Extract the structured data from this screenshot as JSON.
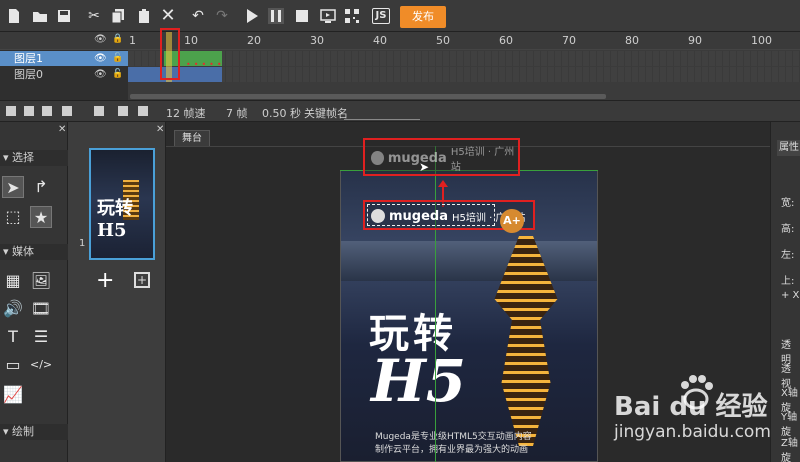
{
  "toolbar": {
    "publish_label": "发布",
    "icons": [
      "new-file-icon",
      "open-folder-icon",
      "save-icon",
      "cut-icon",
      "copy-icon",
      "paste-icon",
      "delete-icon",
      "undo-icon",
      "redo-icon",
      "play-icon",
      "pause-icon",
      "stop-icon",
      "preview-icon",
      "qrcode-icon",
      "js-icon"
    ],
    "accent_color": "#f08c28"
  },
  "timeline": {
    "ruler": [
      "1",
      "10",
      "20",
      "30",
      "40",
      "50",
      "60",
      "70",
      "80",
      "90",
      "100"
    ],
    "layers": [
      {
        "name": "图层1",
        "selected": true
      },
      {
        "name": "图层0",
        "selected": false
      }
    ]
  },
  "statusbar": {
    "fps": "12 帧速",
    "frame": "7 帧",
    "time": "0.50 秒",
    "keyframe_label": "关键帧名",
    "keyframe_value": ""
  },
  "tools": {
    "select_header": "选择",
    "media_header": "媒体",
    "draw_header": "绘制"
  },
  "scenes": {
    "page_number": "1",
    "thumb_title": "玩转H5"
  },
  "stage": {
    "tab_label": "舞台",
    "logo_word": "mugeda",
    "logo_sub": "H5培训 · 广州站",
    "big_text_1": "玩转",
    "big_text_2": "H5",
    "description_1": "Mugeda是专业级HTML5交互动画内容",
    "description_2": "制作云平台，拥有业界最为强大的动画",
    "badge": "A+"
  },
  "props": {
    "tab_label": "属性",
    "labels": [
      "宽:",
      "高:",
      "左:",
      "上:",
      "+ X",
      "透明",
      "透视",
      "X轴旋",
      "Y轴旋",
      "Z轴旋"
    ]
  },
  "watermark": {
    "main": "Bai du 经验",
    "sub": "jingyan.baidu.com"
  }
}
